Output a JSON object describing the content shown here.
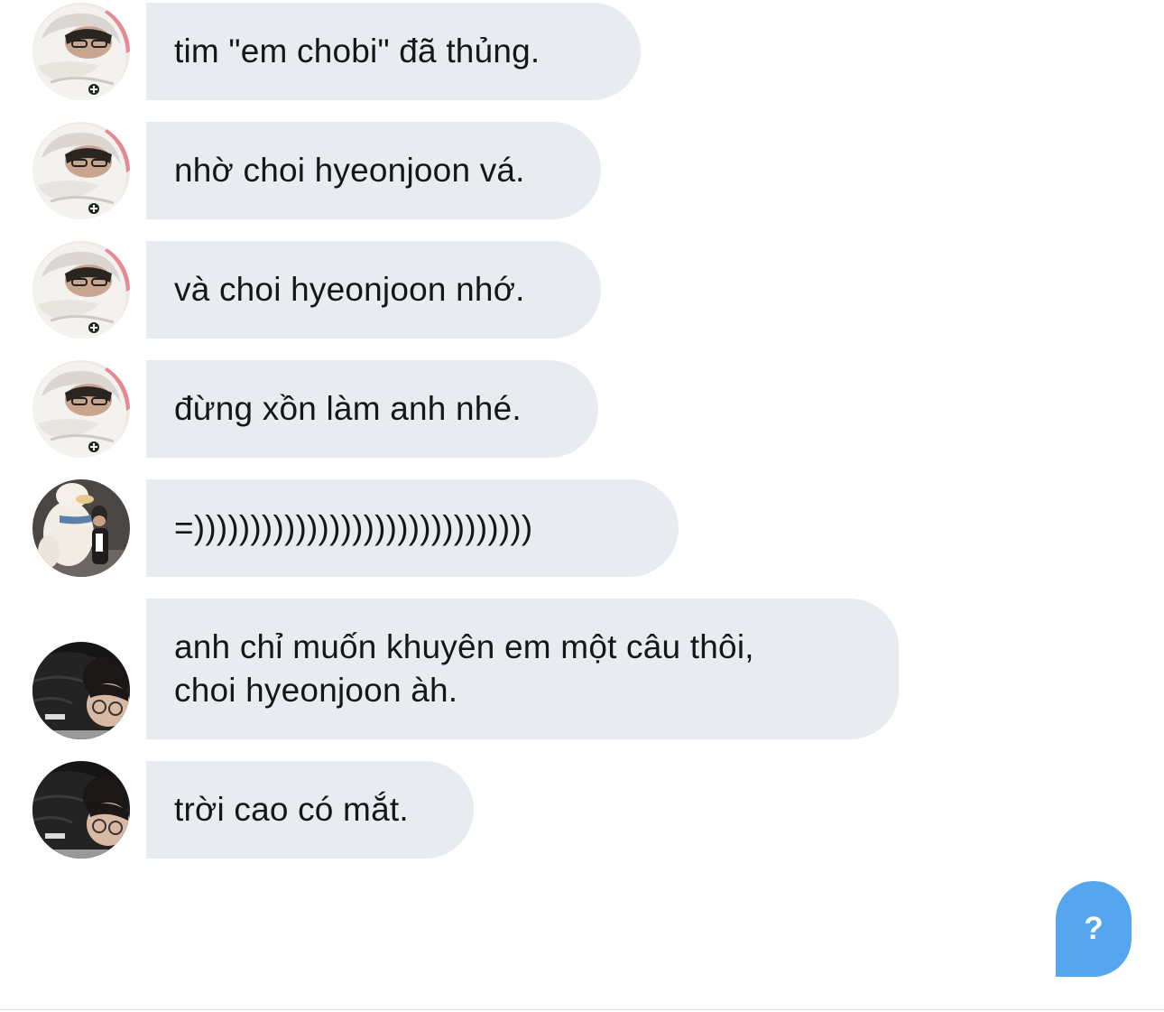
{
  "messages": [
    {
      "avatar": "hoodie-avatar",
      "text": "tim \"em chobi\" đã thủng."
    },
    {
      "avatar": "hoodie-avatar",
      "text": "nhờ choi hyeonjoon vá."
    },
    {
      "avatar": "hoodie-avatar",
      "text": "và choi hyeonjoon nhớ."
    },
    {
      "avatar": "hoodie-avatar",
      "text": "đừng xồn làm anh nhé."
    },
    {
      "avatar": "plush-hug-avatar",
      "text": "=))))))))))))))))))))))))))))))"
    },
    {
      "avatar": "jacket-avatar",
      "text": "anh chỉ muốn khuyên em một câu thôi,\nchoi hyeonjoon àh."
    },
    {
      "avatar": "jacket-avatar",
      "text": "trời cao có mắt."
    }
  ],
  "help_button": {
    "label": "?",
    "icon": "question-icon"
  },
  "colors": {
    "bubble": "#e8ecf0",
    "text": "#14171a",
    "accent": "#55a6ee",
    "background": "#ffffff"
  }
}
